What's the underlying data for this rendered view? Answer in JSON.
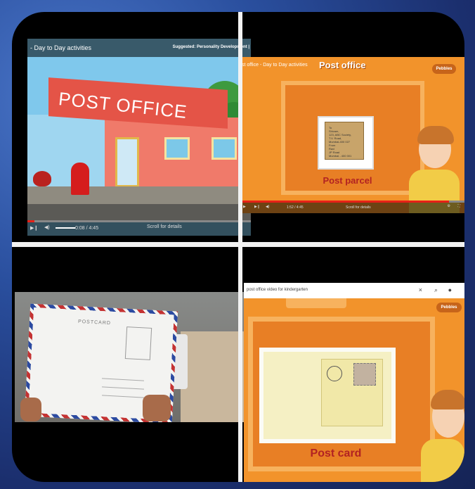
{
  "panel1": {
    "video_title": "- Day to Day activities",
    "suggested": "Suggested: Personality Development |",
    "sign": "POST OFFICE",
    "time": "0:08 / 4:45",
    "scroll_hint": "Scroll for details",
    "progress": 0.03
  },
  "panel2": {
    "video_title": "st office - Day to Day activities",
    "scene_title": "Post office",
    "caption": "Post parcel",
    "parcel_label": "To\nShivam,\n123, ABC Society,\nT.V. Road,\nMumbai-400 027\nFrom\nRavi\nJP Road\nMumbai - 400 001",
    "logo": "Pebbles",
    "time": "1:52 / 4:45",
    "scroll_hint": "Scroll for details",
    "progress": 0.93
  },
  "panel3": {
    "postcard_heading": "POSTCARD"
  },
  "panel4": {
    "search_query": "post office video for kindergarten",
    "caption": "Post card",
    "logo": "Pebbles"
  }
}
